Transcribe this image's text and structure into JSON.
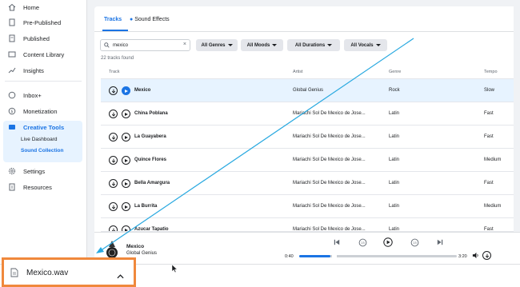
{
  "sidebar": {
    "items": [
      {
        "label": "Home",
        "icon": "home-icon"
      },
      {
        "label": "Pre-Published",
        "icon": "document-icon"
      },
      {
        "label": "Published",
        "icon": "page-icon"
      },
      {
        "label": "Content Library",
        "icon": "library-icon"
      },
      {
        "label": "Insights",
        "icon": "chart-icon"
      },
      {
        "label": "Inbox+",
        "icon": "inbox-icon"
      },
      {
        "label": "Monetization",
        "icon": "dollar-icon"
      },
      {
        "label": "Creative Tools",
        "icon": "creative-tools-icon"
      },
      {
        "label": "Settings",
        "icon": "gear-icon"
      },
      {
        "label": "Resources",
        "icon": "resources-icon"
      }
    ],
    "sub_items": [
      "Live Dashboard",
      "Sound Collection"
    ]
  },
  "tabs": [
    "Tracks",
    "Sound Effects"
  ],
  "search": {
    "value": "mexico"
  },
  "filters": [
    "All Genres",
    "All Moods",
    "All Durations",
    "All Vocals"
  ],
  "count": "22 tracks found",
  "columns": [
    "Track",
    "Artist",
    "Genre",
    "Tempo"
  ],
  "rows": [
    {
      "track": "Mexico",
      "artist": "Global Genius",
      "genre": "Rock",
      "tempo": "Slow"
    },
    {
      "track": "China Poblana",
      "artist": "Mariachi Sol De Mexico de Jose...",
      "genre": "Latin",
      "tempo": "Fast"
    },
    {
      "track": "La Guayabera",
      "artist": "Mariachi Sol De Mexico de Jose...",
      "genre": "Latin",
      "tempo": "Fast"
    },
    {
      "track": "Quince Flores",
      "artist": "Mariachi Sol De Mexico de Jose...",
      "genre": "Latin",
      "tempo": "Medium"
    },
    {
      "track": "Bella Amargura",
      "artist": "Mariachi Sol De Mexico de Jose...",
      "genre": "Latin",
      "tempo": "Fast"
    },
    {
      "track": "La Burrita",
      "artist": "Mariachi Sol De Mexico de Jose...",
      "genre": "Latin",
      "tempo": "Medium"
    },
    {
      "track": "Azucar Tapatio",
      "artist": "Mariachi Sol De Mexico de Jose...",
      "genre": "Latin",
      "tempo": "Fast"
    }
  ],
  "player": {
    "title": "Mexico",
    "artist": "Global Genius",
    "elapsed": "0:40",
    "total": "3:20",
    "progress": 0.2
  },
  "download": {
    "filename": "Mexico.wav"
  },
  "colors": {
    "accent": "#1b74e4",
    "highlight": "#e7f3ff",
    "download_border": "#f0883c",
    "annotation_arrow": "#29a9e0"
  }
}
